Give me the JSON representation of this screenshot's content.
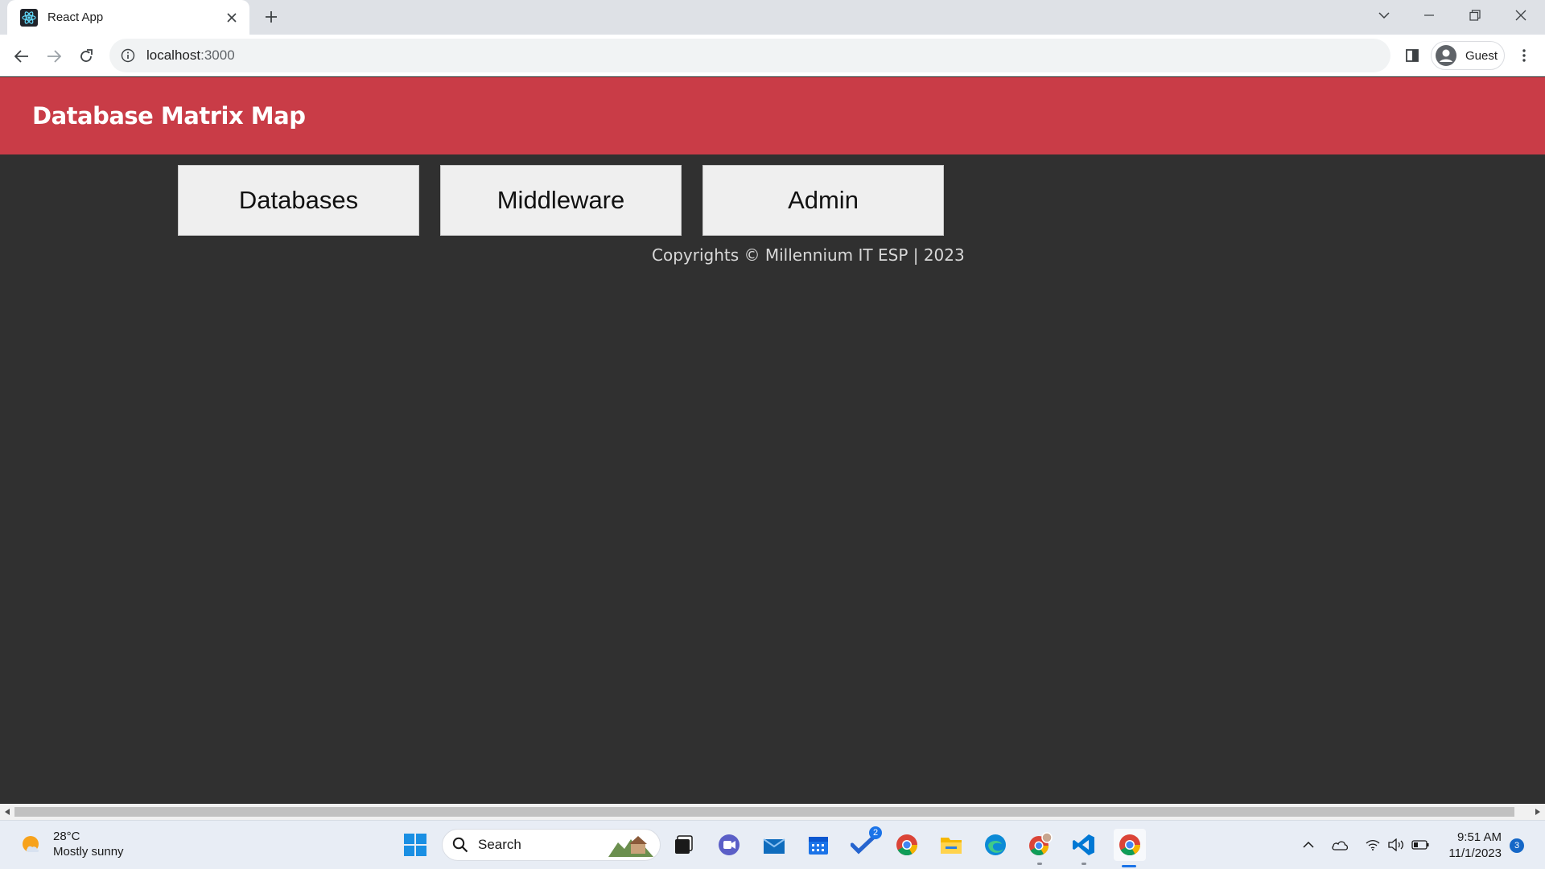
{
  "browser": {
    "tab_title": "React App",
    "url_host": "localhost",
    "url_port": ":3000",
    "profile_label": "Guest"
  },
  "page": {
    "header_title": "Database Matrix Map",
    "nav_buttons": [
      "Databases",
      "Middleware",
      "Admin"
    ],
    "footer_text": "Copyrights © Millennium IT ESP | 2023"
  },
  "colors": {
    "header_bg": "#c93c47",
    "page_bg": "#303030",
    "button_bg": "#efefef"
  },
  "taskbar": {
    "weather_temp": "28°C",
    "weather_desc": "Mostly sunny",
    "search_label": "Search",
    "todo_badge": "2",
    "time": "9:51 AM",
    "date": "11/1/2023",
    "notification_count": "3",
    "apps": [
      "windows-start",
      "search",
      "task-view",
      "teams-meet",
      "mail",
      "calendar",
      "todo",
      "chrome",
      "file-explorer",
      "edge",
      "chrome-profile",
      "vscode",
      "chrome-active"
    ]
  }
}
